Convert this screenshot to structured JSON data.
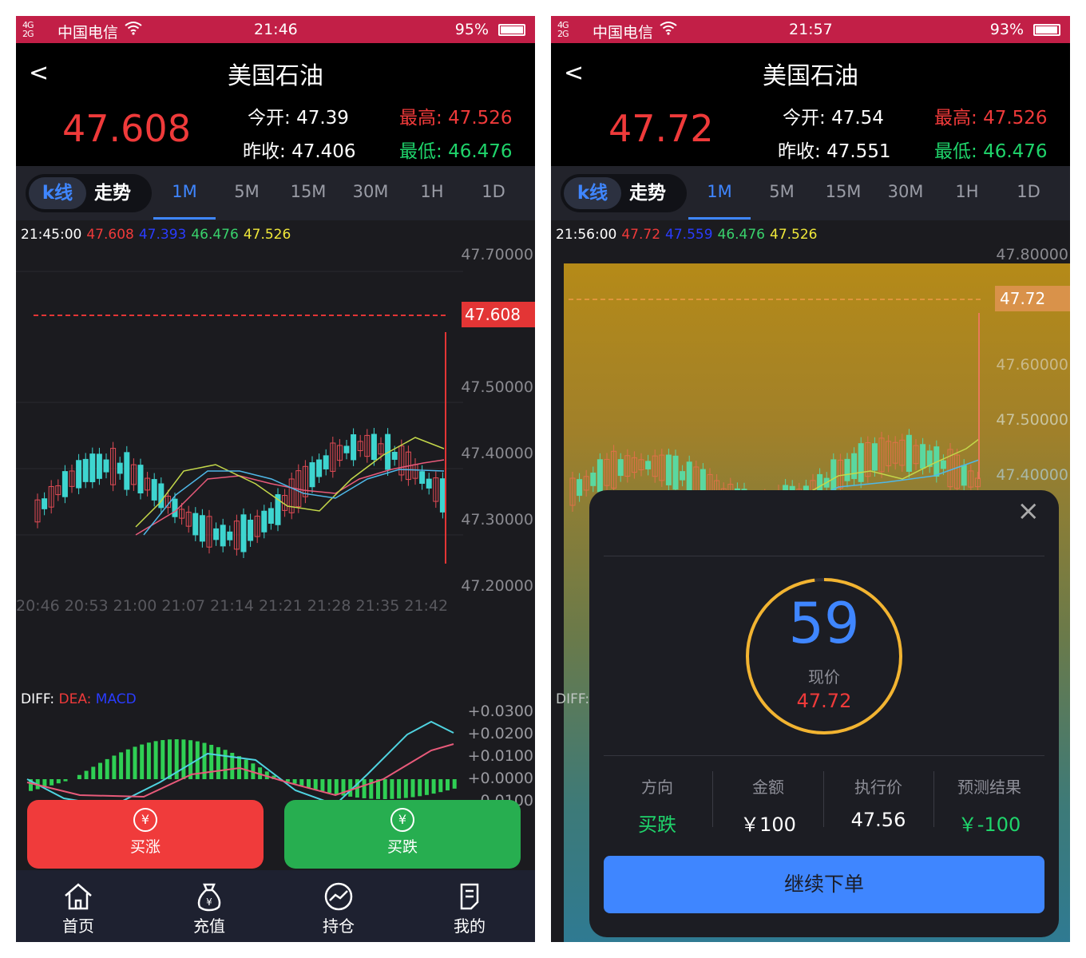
{
  "left": {
    "status": {
      "signal": "4G\n2G",
      "carrier": "中国电信",
      "time": "21:46",
      "battery": "95%",
      "battery_level": 0.95
    },
    "header": {
      "back": "<",
      "title": "美国石油",
      "price": "47.608",
      "open_label": "今开:",
      "open": "47.39",
      "high_label": "最高:",
      "high": "47.526",
      "prevclose_label": "昨收:",
      "prevclose": "47.406",
      "low_label": "最低:",
      "low": "46.476"
    },
    "tabs": {
      "kline": "k线",
      "trend": "走势",
      "periods": [
        "1M",
        "5M",
        "15M",
        "30M",
        "1H",
        "1D"
      ],
      "active": "1M"
    },
    "chart_info": {
      "time": "21:45:00",
      "v1": "47.608",
      "v2": "47.393",
      "v3": "46.476",
      "v4": "47.526"
    },
    "y_labels": [
      "47.70000",
      "47.50000",
      "47.40000",
      "47.30000",
      "47.20000"
    ],
    "price_tag": "47.608",
    "x_labels": "20:46 20:53 21:00 21:07 21:14 21:21 21:28 21:35 21:42",
    "macd": {
      "diff": "DIFF:",
      "dea": "DEA:",
      "macd": "MACD",
      "labels": [
        "+0.0300",
        "+0.0200",
        "+0.0100",
        "+0.0000",
        "-0.0100"
      ]
    },
    "buttons": {
      "up_icon": "¥",
      "up": "买涨",
      "down_icon": "¥",
      "down": "买跌"
    },
    "nav": [
      "首页",
      "充值",
      "持仓",
      "我的"
    ]
  },
  "right": {
    "status": {
      "signal": "4G\n2G",
      "carrier": "中国电信",
      "time": "21:57",
      "battery": "93%",
      "battery_level": 0.93
    },
    "header": {
      "back": "<",
      "title": "美国石油",
      "price": "47.72",
      "open_label": "今开:",
      "open": "47.54",
      "high_label": "最高:",
      "high": "47.526",
      "prevclose_label": "昨收:",
      "prevclose": "47.551",
      "low_label": "最低:",
      "low": "46.476"
    },
    "tabs": {
      "kline": "k线",
      "trend": "走势",
      "periods": [
        "1M",
        "5M",
        "15M",
        "30M",
        "1H",
        "1D"
      ],
      "active": "1M"
    },
    "chart_info": {
      "time": "21:56:00",
      "v1": "47.72",
      "v2": "47.559",
      "v3": "46.476",
      "v4": "47.526"
    },
    "y_labels": [
      "47.80000",
      "47.60000",
      "47.50000",
      "47.40000"
    ],
    "price_tag": "47.72",
    "macd_label": "DIFF:",
    "modal": {
      "close": "×",
      "countdown": "59",
      "countdown_progress": 0.98,
      "current_label": "现价",
      "current_price": "47.72",
      "columns": [
        {
          "header": "方向",
          "value": "买跌",
          "color": "#1fd46b"
        },
        {
          "header": "金额",
          "value": "￥100",
          "color": "#ffffff"
        },
        {
          "header": "执行价",
          "value": "47.56",
          "color": "#ffffff"
        },
        {
          "header": "预测结果",
          "value": "￥-100",
          "color": "#1fd46b"
        }
      ],
      "confirm": "继续下单"
    }
  }
}
